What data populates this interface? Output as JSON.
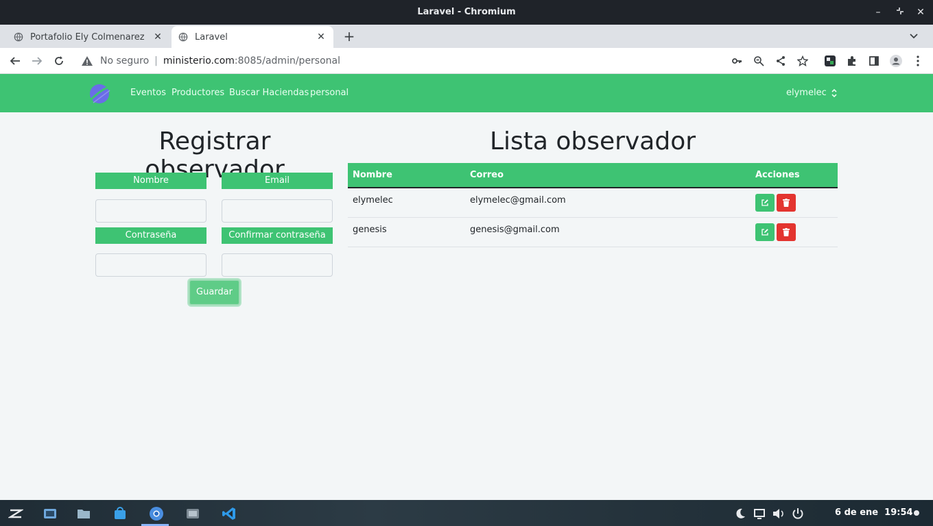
{
  "window": {
    "title": "Laravel - Chromium"
  },
  "tabs": [
    {
      "title": "Portafolio Ely Colmenarez",
      "icon": "globe-icon"
    },
    {
      "title": "Laravel",
      "icon": "globe-icon"
    }
  ],
  "omnibox": {
    "security": "No seguro",
    "host": "ministerio.com",
    "path": ":8085/admin/personal"
  },
  "navbar": {
    "links": [
      "Eventos",
      "Productores",
      "Buscar Haciendas",
      "personal"
    ],
    "user": "elymelec"
  },
  "form": {
    "heading": "Registrar observador",
    "labels": {
      "name": "Nombre",
      "email": "Email",
      "password": "Contraseña",
      "confirm": "Confirmar contraseña"
    },
    "save_label": "Guardar"
  },
  "list": {
    "heading": "Lista observador",
    "columns": [
      "Nombre",
      "Correo",
      "Acciones"
    ],
    "rows": [
      {
        "name": "elymelec",
        "email": "elymelec@gmail.com"
      },
      {
        "name": "genesis",
        "email": "genesis@gmail.com"
      }
    ]
  },
  "taskbar": {
    "date": "6 de ene",
    "time": "19:54"
  },
  "colors": {
    "brand": "#3ec373",
    "danger": "#e3342f",
    "page_bg": "#f3f6f7"
  }
}
